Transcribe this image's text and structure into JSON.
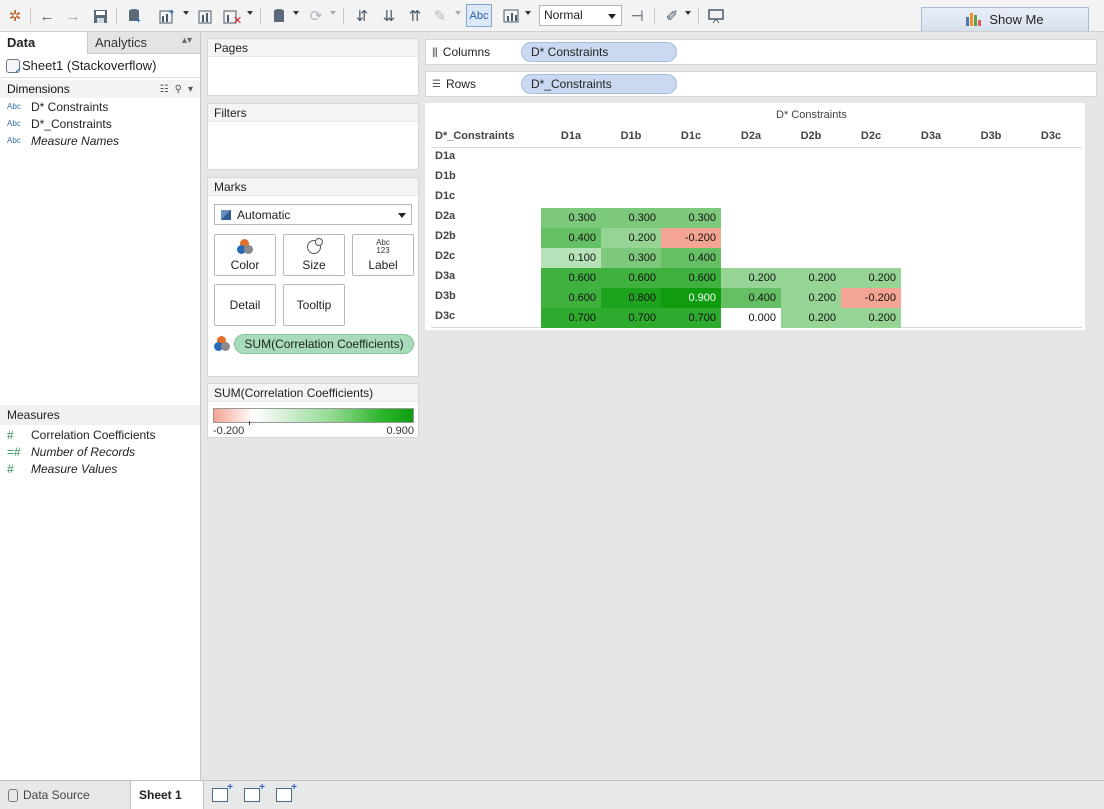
{
  "toolbar": {
    "zoom_value": "Normal",
    "abc_label": "Abc",
    "show_me_label": "Show Me",
    "show_me_bar_colors": [
      "#4e79a7",
      "#f28e2b",
      "#59a14f",
      "#e15759"
    ]
  },
  "left": {
    "tabs": {
      "data": "Data",
      "analytics": "Analytics"
    },
    "source": "Sheet1 (Stackoverflow)",
    "dimensions_title": "Dimensions",
    "dimensions": [
      {
        "label": "D* Constraints",
        "italic": false
      },
      {
        "label": "D*_Constraints",
        "italic": false
      },
      {
        "label": "Measure Names",
        "italic": true
      }
    ],
    "abc_icon": "Abc",
    "measures_title": "Measures",
    "measures": [
      {
        "label": "Correlation Coefficients",
        "italic": false
      },
      {
        "label": "Number of Records",
        "italic": true
      },
      {
        "label": "Measure Values",
        "italic": true
      }
    ]
  },
  "cards": {
    "pages": "Pages",
    "filters": "Filters",
    "marks": "Marks",
    "mark_type": "Automatic",
    "buttons": {
      "color": "Color",
      "size": "Size",
      "label": "Label",
      "detail": "Detail",
      "tooltip": "Tooltip"
    },
    "color_pill": "SUM(Correlation Coefficients)",
    "legend_title": "SUM(Correlation Coefficients)",
    "legend_min": "-0.200",
    "legend_max": "0.900"
  },
  "shelves": {
    "columns_label": "Columns",
    "columns_pill": "D* Constraints",
    "rows_label": "Rows",
    "rows_pill": "D*_Constraints"
  },
  "chart_data": {
    "type": "heatmap",
    "title": "D* Constraints",
    "row_header": "D*_Constraints",
    "columns": [
      "D1a",
      "D1b",
      "D1c",
      "D2a",
      "D2b",
      "D2c",
      "D3a",
      "D3b",
      "D3c"
    ],
    "rows": [
      "D1a",
      "D1b",
      "D1c",
      "D2a",
      "D2b",
      "D2c",
      "D3a",
      "D3b",
      "D3c"
    ],
    "values": [
      [
        null,
        null,
        null,
        null,
        null,
        null,
        null,
        null,
        null
      ],
      [
        null,
        null,
        null,
        null,
        null,
        null,
        null,
        null,
        null
      ],
      [
        null,
        null,
        null,
        null,
        null,
        null,
        null,
        null,
        null
      ],
      [
        "0.300",
        "0.300",
        "0.300",
        null,
        null,
        null,
        null,
        null,
        null
      ],
      [
        "0.400",
        "0.200",
        "-0.200",
        null,
        null,
        null,
        null,
        null,
        null
      ],
      [
        "0.100",
        "0.300",
        "0.400",
        null,
        null,
        null,
        null,
        null,
        null
      ],
      [
        "0.600",
        "0.600",
        "0.600",
        "0.200",
        "0.200",
        "0.200",
        null,
        null,
        null
      ],
      [
        "0.600",
        "0.800",
        "0.900",
        "0.400",
        "0.200",
        "-0.200",
        null,
        null,
        null
      ],
      [
        "0.700",
        "0.700",
        "0.700",
        "0.000",
        "0.200",
        "0.200",
        null,
        null,
        null
      ]
    ],
    "color_range": [
      -0.2,
      0.9
    ],
    "colors": {
      "negative": "#f4a493",
      "zero": "#ffffff",
      "positive_max": "#0f9d0f"
    }
  },
  "bottom": {
    "data_source": "Data Source",
    "sheet": "Sheet 1"
  }
}
